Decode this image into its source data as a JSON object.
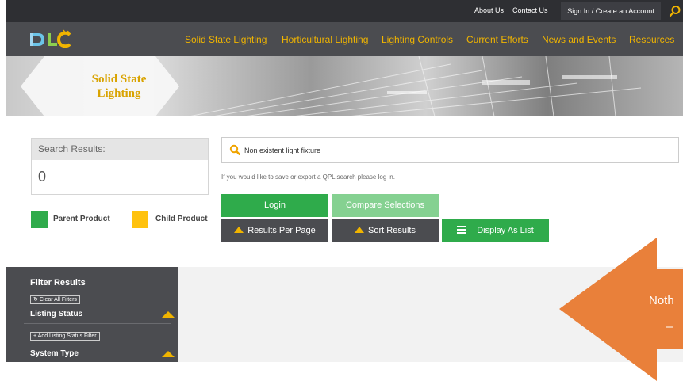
{
  "topbar": {
    "about": "About Us",
    "contact": "Contact Us",
    "signin": "Sign In / Create an Account"
  },
  "nav": {
    "logo": "DLC",
    "items": [
      "Solid State Lighting",
      "Horticultural Lighting",
      "Lighting Controls",
      "Current Efforts",
      "News and Events",
      "Resources"
    ]
  },
  "hero": {
    "title_line1": "Solid State",
    "title_line2": "Lighting"
  },
  "results": {
    "label": "Search Results:",
    "count": "0"
  },
  "legend": {
    "parent": "Parent Product",
    "child": "Child Product"
  },
  "search": {
    "value": "Non existent light fixture",
    "note": "If you would like to save or export a QPL search please log in."
  },
  "buttons": {
    "login": "Login",
    "compare": "Compare Selections",
    "per_page": "Results Per Page",
    "sort": "Sort Results",
    "display": "Display As List"
  },
  "filters": {
    "title": "Filter Results",
    "clear": "Clear All Filters",
    "listing_status": "Listing Status",
    "add_listing": "Add Listing Status Filter",
    "system_type": "System Type"
  },
  "callout": {
    "text": "Noth",
    "dash": "–"
  },
  "colors": {
    "green": "#2fab4b",
    "light_green": "#85d191",
    "gold": "#f0b400",
    "dark": "#4b4c50",
    "orange": "#e9803a"
  }
}
